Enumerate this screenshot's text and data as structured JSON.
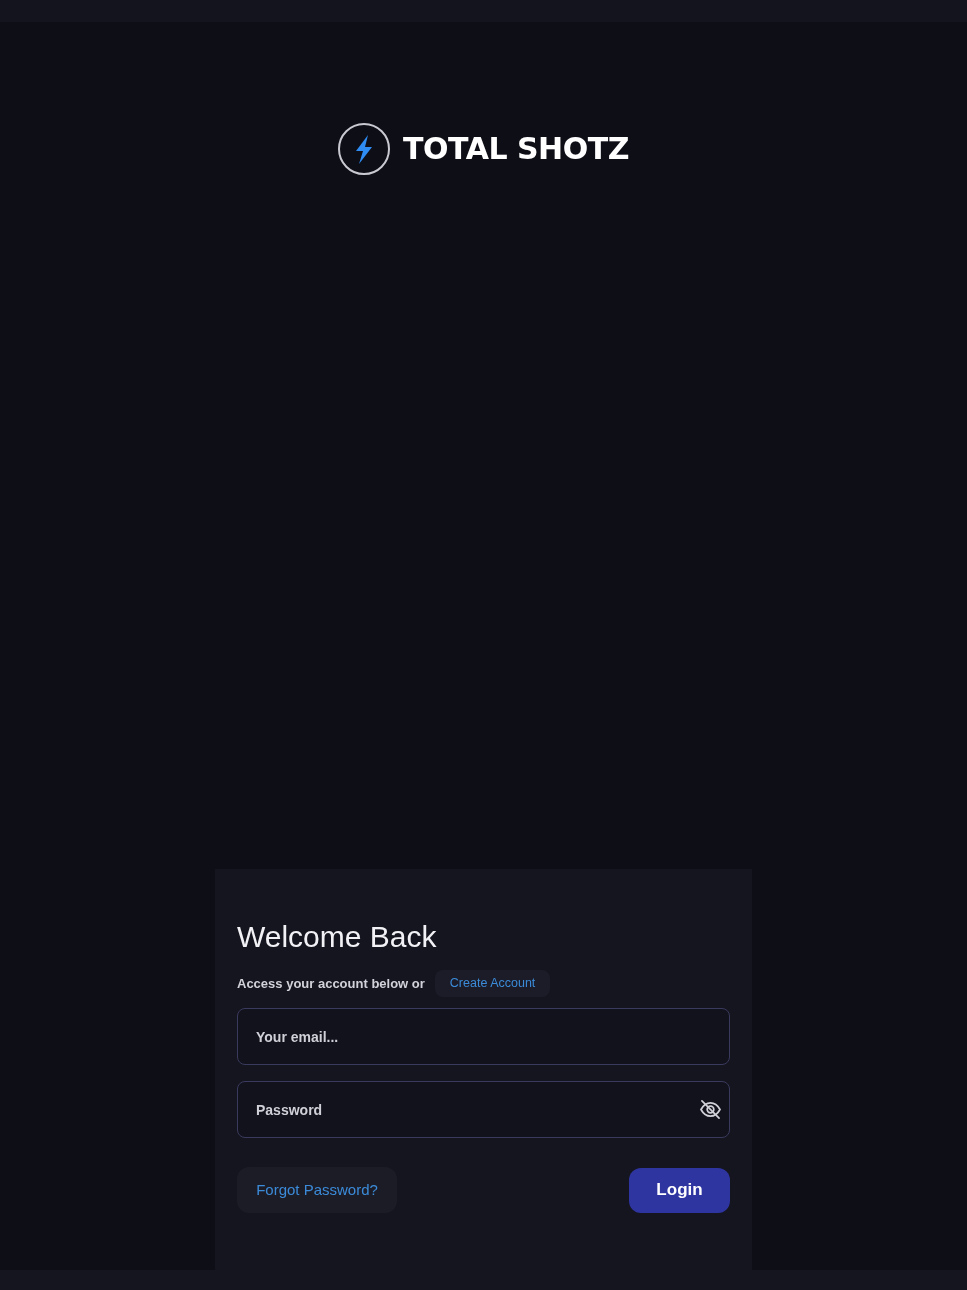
{
  "logo": {
    "text": "TOTAL SHOTZ"
  },
  "card": {
    "title": "Welcome Back",
    "subtitle": "Access your account below or",
    "create_account": "Create Account",
    "email": {
      "placeholder": "Your email..."
    },
    "password": {
      "placeholder": "Password",
      "visible": false
    },
    "forgot_password": "Forgot Password?",
    "login": "Login"
  }
}
